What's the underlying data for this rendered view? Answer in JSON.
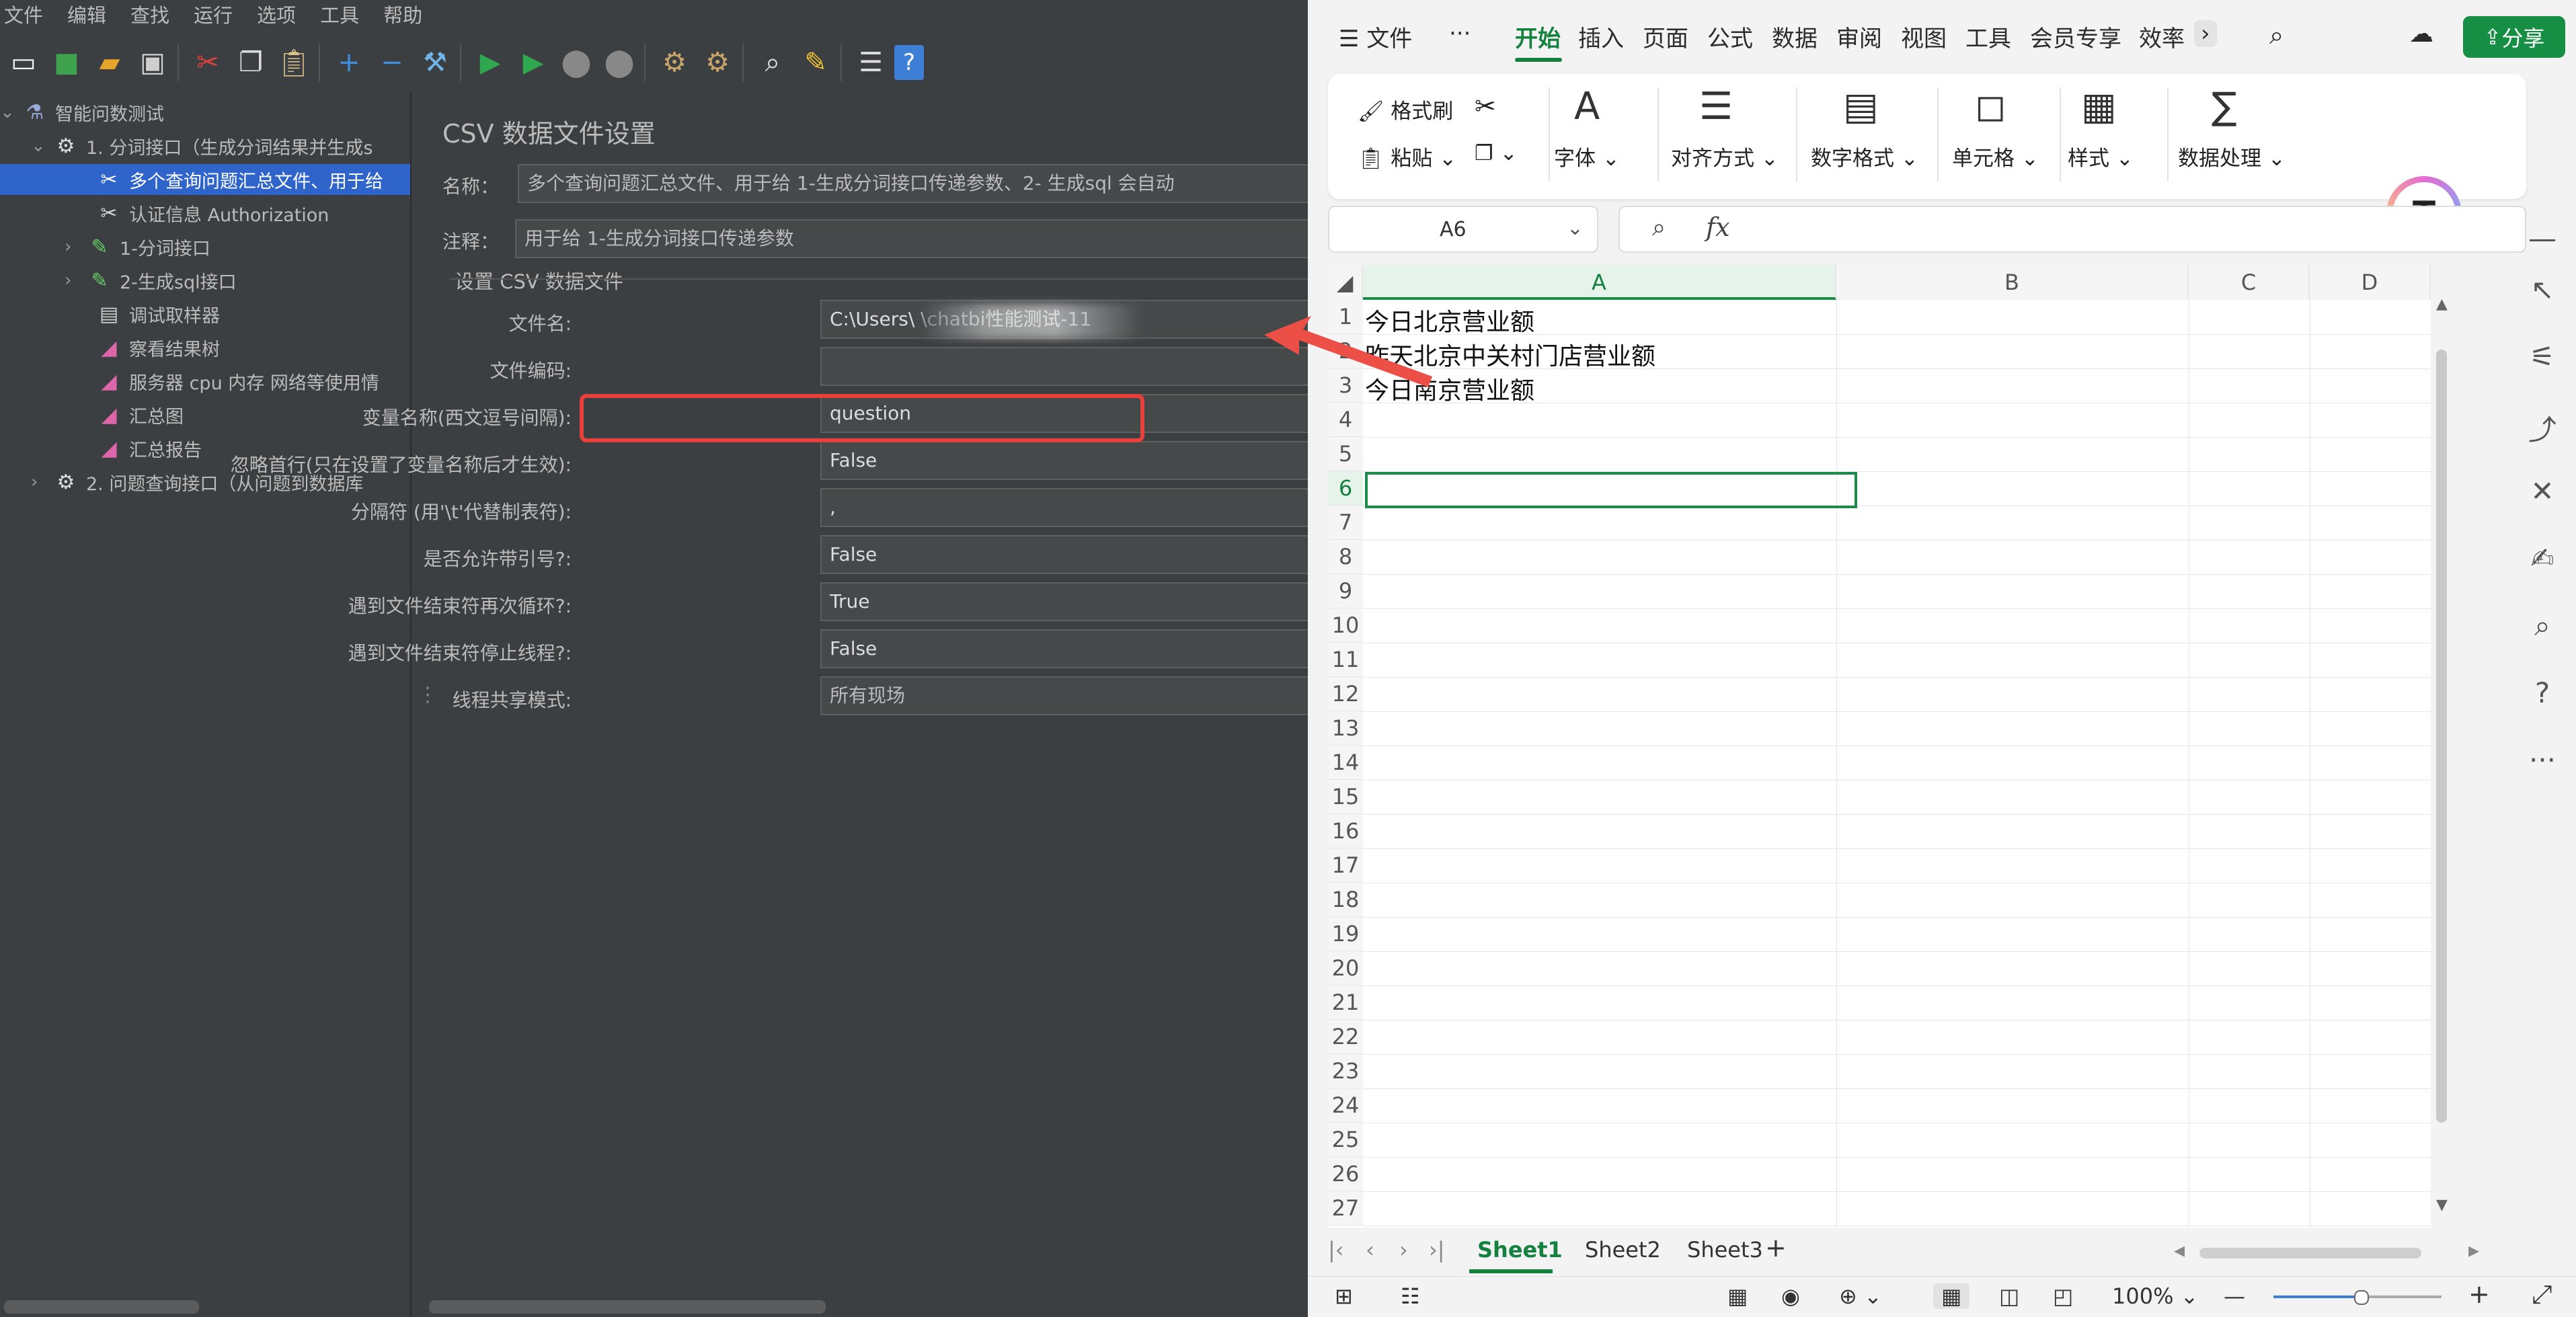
{
  "jmeter": {
    "menu": [
      "文件",
      "编辑",
      "查找",
      "运行",
      "选项",
      "工具",
      "帮助"
    ],
    "tree": [
      {
        "label": "智能问数测试",
        "level": 0
      },
      {
        "label": "1. 分词接口（生成分词结果并生成s",
        "level": 1
      },
      {
        "label": "多个查询问题汇总文件、用于给",
        "level": 2,
        "selected": true
      },
      {
        "label": "认证信息 Authorization",
        "level": 2
      },
      {
        "label": "1-分词接口",
        "level": 2
      },
      {
        "label": "2-生成sql接口",
        "level": 2
      },
      {
        "label": "调试取样器",
        "level": 2
      },
      {
        "label": "察看结果树",
        "level": 2
      },
      {
        "label": "服务器 cpu 内存 网络等使用情",
        "level": 2
      },
      {
        "label": "汇总图",
        "level": 2
      },
      {
        "label": "汇总报告",
        "level": 2
      },
      {
        "label": "2. 问题查询接口（从问题到数据库",
        "level": 1
      }
    ],
    "panel_title": "CSV 数据文件设置",
    "name_label": "名称：",
    "name_value": "多个查询问题汇总文件、用于给 1-生成分词接口传递参数、2- 生成sql 会自动",
    "comment_label": "注释：",
    "comment_value": "用于给 1-生成分词接口传递参数",
    "section_title": "设置 CSV 数据文件",
    "fields": [
      {
        "label": "文件名:",
        "value": "C:\\Users\\                        \\chatbi性能测试-11"
      },
      {
        "label": "文件编码:",
        "value": ""
      },
      {
        "label": "变量名称(西文逗号间隔):",
        "value": "question"
      },
      {
        "label": "忽略首行(只在设置了变量名称后才生效):",
        "value": "False"
      },
      {
        "label": "分隔符 (用'\\t'代替制表符):",
        "value": ","
      },
      {
        "label": "是否允许带引号?:",
        "value": "False"
      },
      {
        "label": "遇到文件结束符再次循环?:",
        "value": "True"
      },
      {
        "label": "遇到文件结束符停止线程?:",
        "value": "False"
      },
      {
        "label": "线程共享模式:",
        "value": "所有现场"
      }
    ]
  },
  "wps": {
    "menu_label": "文件",
    "more": "···",
    "tabs": [
      "开始",
      "插入",
      "页面",
      "公式",
      "数据",
      "审阅",
      "视图",
      "工具",
      "会员专享",
      "效率"
    ],
    "share": "分享",
    "ribbon": {
      "format_painter": "格式刷",
      "paste": "粘贴",
      "font": "字体",
      "align": "对齐方式",
      "number_format": "数字格式",
      "cells": "单元格",
      "style": "样式",
      "data_process": "数据处理"
    },
    "name_box": "A6",
    "fx": "fx",
    "columns": [
      "A",
      "B",
      "C",
      "D"
    ],
    "rows": [
      "1",
      "2",
      "3",
      "4",
      "5",
      "6",
      "7",
      "8",
      "9",
      "10",
      "11",
      "12",
      "13",
      "14",
      "15",
      "16",
      "17",
      "18",
      "19",
      "20",
      "21",
      "22",
      "23",
      "24",
      "25",
      "26",
      "27"
    ],
    "cells": [
      "今日北京营业额",
      "昨天北京中关村门店营业额",
      "今日南京营业额"
    ],
    "sheets": [
      "Sheet1",
      "Sheet2",
      "Sheet3"
    ],
    "zoom": "100%"
  }
}
